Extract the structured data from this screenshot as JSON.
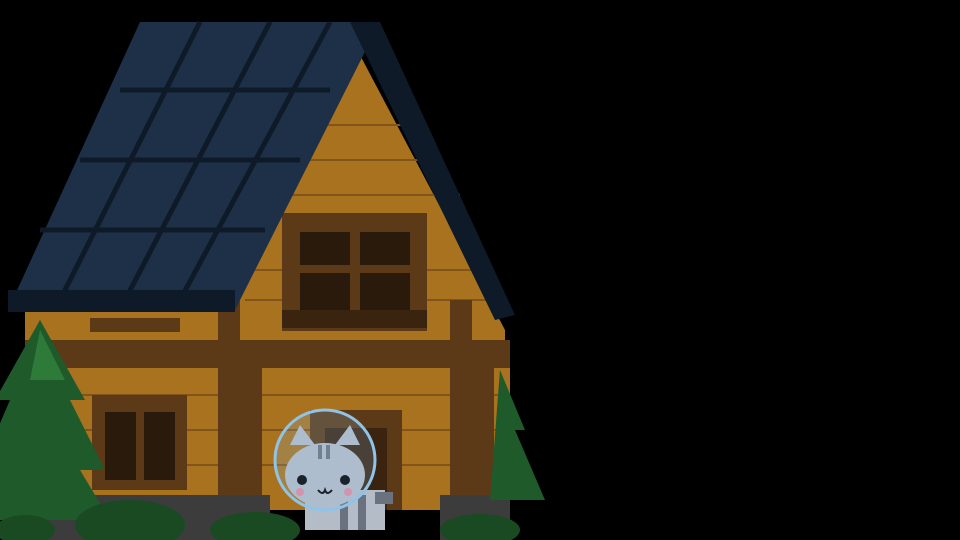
{
  "scene": {
    "setting": "night",
    "colors": {
      "background": "#000000",
      "roof": "#1d3047",
      "roof_dark": "#0e1a28",
      "brick": "#a8721f",
      "brick_line": "#80541a",
      "timber": "#5c3a18",
      "timber_dark": "#3a2410",
      "window_glass": "#2a1a0c",
      "stone": "#3c3c3c",
      "tree": "#1f5a2a",
      "tree_light": "#2e7a38",
      "bush": "#1a4a22",
      "cat_fur": "#b4bcc8",
      "cat_stripe": "#6a7280",
      "cat_blush": "#e08aa0",
      "bubble": "#8fc4e8"
    }
  },
  "player": {
    "character": "cat",
    "wearing": "bubble-helmet",
    "facing": "down"
  },
  "objects": [
    "house",
    "pine-tree-left",
    "pine-tree-right",
    "bush-row",
    "cat-player"
  ]
}
